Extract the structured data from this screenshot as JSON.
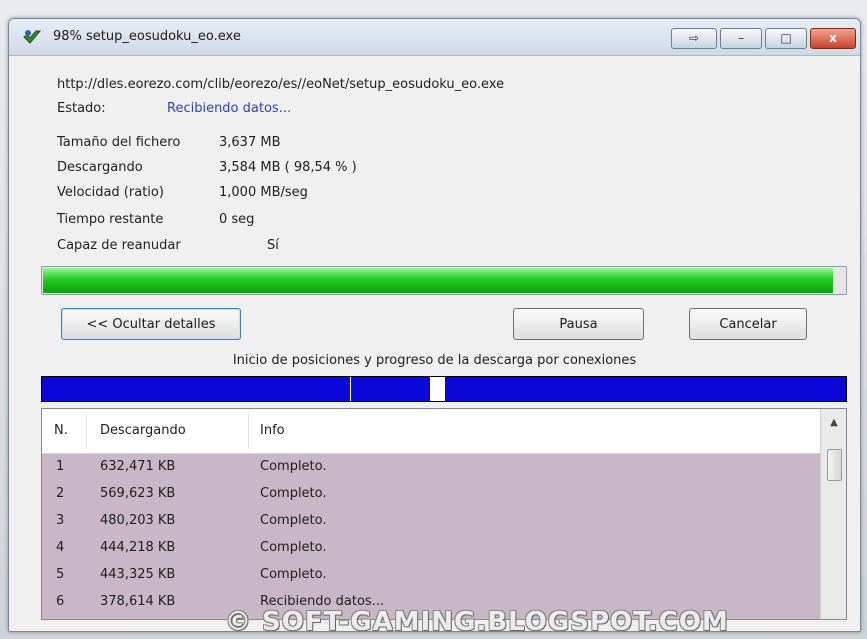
{
  "window": {
    "title": "98% setup_eosudoku_eo.exe",
    "close_glyph": "x",
    "min_glyph": "–",
    "max_glyph": "□",
    "arrow_glyph": "⇨"
  },
  "download": {
    "url": "http://dles.eorezo.com/clib/eorezo/es//eoNet/setup_eosudoku_eo.exe",
    "status_label": "Estado:",
    "status_value": "Recibiendo datos...",
    "fields": [
      {
        "label": "Tamaño del fichero",
        "value": "3,637  MB"
      },
      {
        "label": "Descargando",
        "value": "3,584  MB  ( 98,54 % )"
      },
      {
        "label": "Velocidad (ratio)",
        "value": "1,000  MB/seg"
      },
      {
        "label": "Tiempo restante",
        "value": "0 seg"
      },
      {
        "label": "Capaz de reanudar",
        "value": "Sí"
      }
    ],
    "progress_fraction": 0.9854
  },
  "buttons": {
    "details": "<< Ocultar detalles",
    "pause": "Pausa",
    "cancel": "Cancelar"
  },
  "connections": {
    "caption": "Inicio de posiciones y progreso de la descarga por conexiones"
  },
  "table": {
    "columns": [
      "N.",
      "Descargando",
      "Info"
    ],
    "rows": [
      {
        "n": "1",
        "size": "632,471  KB",
        "info": "Completo."
      },
      {
        "n": "2",
        "size": "569,623  KB",
        "info": "Completo."
      },
      {
        "n": "3",
        "size": "480,203  KB",
        "info": "Completo."
      },
      {
        "n": "4",
        "size": "444,218  KB",
        "info": "Completo."
      },
      {
        "n": "5",
        "size": "443,325  KB",
        "info": "Completo."
      },
      {
        "n": "6",
        "size": "378,614  KB",
        "info": "Recibiendo datos..."
      }
    ]
  },
  "watermark": "© SOFT-GAMING.BLOGSPOT.COM",
  "colors": {
    "progress_green": "#1ecb1e",
    "connection_blue": "#0a07d8",
    "rows_bg": "#c9b7c7",
    "status_blue": "#2b3fbf"
  },
  "icons": {
    "app": "eorezo-app-icon",
    "scroll_up": "chevron-up-icon"
  }
}
